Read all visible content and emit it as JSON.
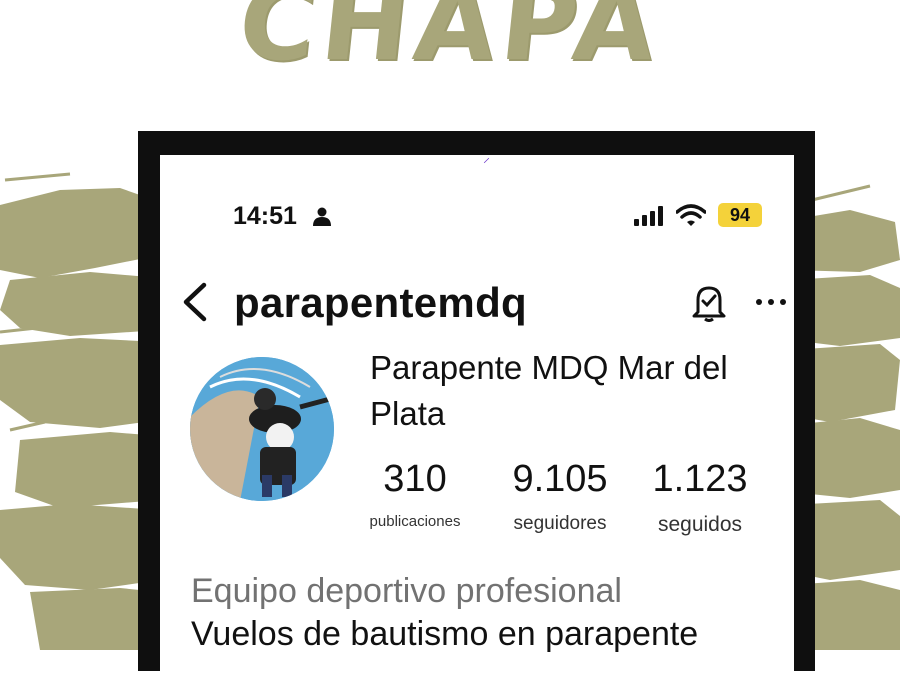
{
  "headline": "CHAPA",
  "colors": {
    "olive": "#a8a67a",
    "frame": "#0f0f0f",
    "battery": "#f4d23a",
    "category_gray": "#727272"
  },
  "status_bar": {
    "time": "14:51",
    "battery": "94",
    "icons": [
      "person-icon",
      "signal-icon",
      "wifi-icon"
    ]
  },
  "header": {
    "username": "parapentemdq",
    "icons": [
      "back-arrow-icon",
      "bell-icon",
      "more-icon"
    ]
  },
  "profile": {
    "display_name": "Parapente MDQ Mar del Plata",
    "stats": [
      {
        "value": "310",
        "label": "publicaciones"
      },
      {
        "value": "9.105",
        "label": "seguidores"
      },
      {
        "value": "1.123",
        "label": "seguidos"
      }
    ]
  },
  "bio": {
    "category": "Equipo deportivo profesional",
    "line1": "Vuelos de bautismo en parapente"
  }
}
